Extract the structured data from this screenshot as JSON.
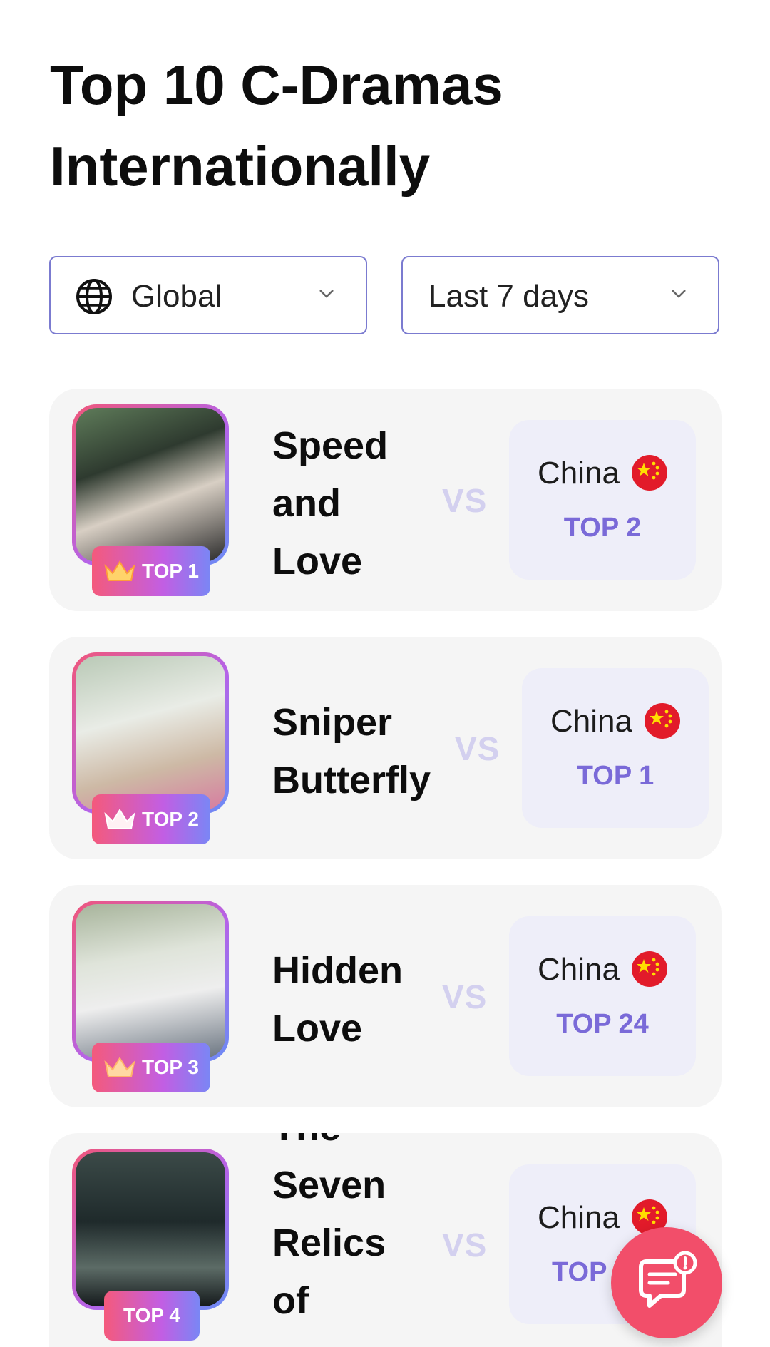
{
  "page": {
    "title_line1": "Top 10 C-Dramas",
    "title_line2": "Internationally"
  },
  "filters": {
    "region": {
      "value": "Global",
      "icon": "globe-icon"
    },
    "period": {
      "value": "Last 7 days"
    }
  },
  "rankings": [
    {
      "badge": "TOP 1",
      "title_lines": [
        "Speed",
        "and",
        "Love"
      ],
      "vs": "VS",
      "country": "China",
      "country_rank": "TOP 2"
    },
    {
      "badge": "TOP 2",
      "title_lines": [
        "Sniper",
        "Butterfly"
      ],
      "vs": "VS",
      "country": "China",
      "country_rank": "TOP 1"
    },
    {
      "badge": "TOP 3",
      "title_lines": [
        "Hidden",
        "Love"
      ],
      "vs": "VS",
      "country": "China",
      "country_rank": "TOP 24"
    },
    {
      "badge": "TOP 4",
      "title_lines": [
        "The",
        "Seven",
        "Relics",
        "of"
      ],
      "vs": "VS",
      "country": "China",
      "country_rank": "TOP"
    }
  ],
  "colors": {
    "accent": "#7a6ad8",
    "badge_gradient_start": "#f45a7c",
    "badge_gradient_end": "#7a86f5",
    "chat_button": "#f24e6a"
  }
}
